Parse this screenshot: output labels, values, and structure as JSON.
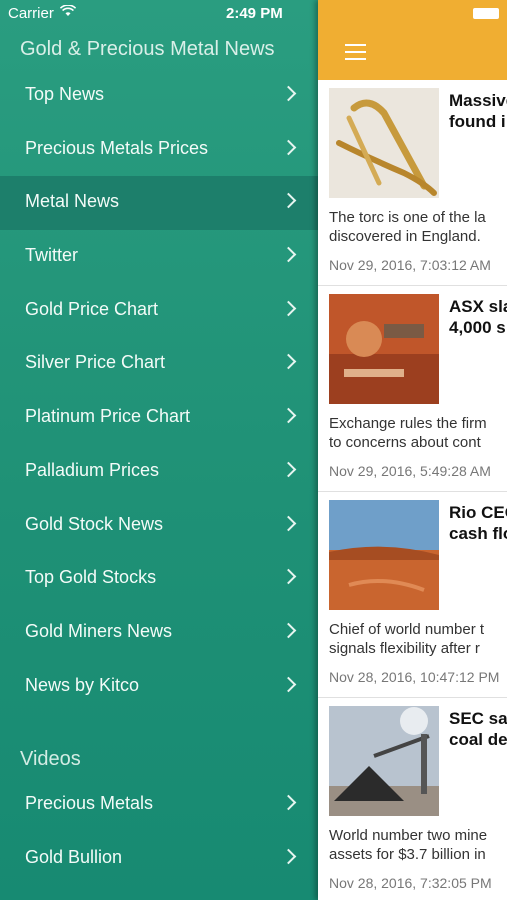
{
  "status": {
    "carrier": "Carrier",
    "time": "2:49 PM"
  },
  "app_title": "Gold & Precious Metal News",
  "menu": [
    {
      "label": "Top News"
    },
    {
      "label": "Precious Metals Prices"
    },
    {
      "label": "Metal News",
      "active": true
    },
    {
      "label": "Twitter"
    },
    {
      "label": "Gold Price Chart"
    },
    {
      "label": "Silver Price Chart"
    },
    {
      "label": "Platinum Price Chart"
    },
    {
      "label": "Palladium Prices"
    },
    {
      "label": "Gold Stock News"
    },
    {
      "label": "Top Gold Stocks"
    },
    {
      "label": "Gold Miners News"
    },
    {
      "label": "News by Kitco"
    }
  ],
  "videos_label": "Videos",
  "video_items": [
    {
      "label": "Precious Metals"
    },
    {
      "label": "Gold Bullion"
    }
  ],
  "colors": {
    "sidebar": "#1f9478",
    "active_row": "#1d7f6b",
    "topbar": "#f0ae32"
  },
  "feed": [
    {
      "headline1": "Massive",
      "headline2": "found i",
      "summary1": "The torc is one of the la",
      "summary2": "discovered in England.",
      "date": "Nov 29, 2016, 7:03:12 AM"
    },
    {
      "headline1": "ASX sla",
      "headline2": "4,000 s",
      "summary1": "Exchange rules the firm",
      "summary2": "to concerns about cont",
      "date": "Nov 29, 2016, 5:49:28 AM"
    },
    {
      "headline1": "Rio CEO",
      "headline2": "cash flo",
      "summary1": "Chief of world number t",
      "summary2": "signals flexibility after r",
      "date": "Nov 28, 2016, 10:47:12 PM"
    },
    {
      "headline1": "SEC sa",
      "headline2": "coal de",
      "summary1": "World number two mine",
      "summary2": "assets for $3.7 billion in",
      "date": "Nov 28, 2016, 7:32:05 PM"
    }
  ]
}
